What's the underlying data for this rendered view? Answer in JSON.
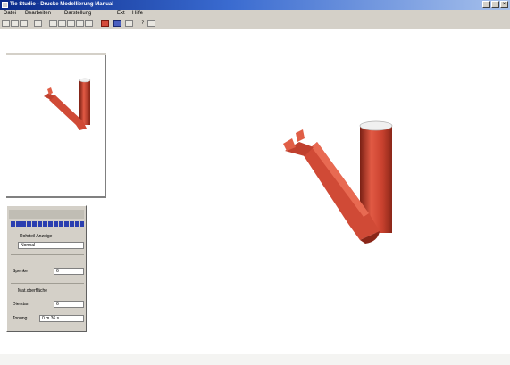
{
  "window": {
    "title": "Tie Studio - Drucke Modellierung Manual"
  },
  "menu": [
    "Datei",
    "Bearbeiten",
    "Darstellung",
    "Ext",
    "Hilfe"
  ],
  "toolbar": {
    "help_label": "?"
  },
  "control_panel": {
    "section1": "Rohrteil Anzeige",
    "select_value": "Normal",
    "row1_label": "Spenke",
    "row1_value": "6",
    "section2": "Mat.oberfläche",
    "row2_label": "Dierstan",
    "row2_value": "6",
    "row3_label": "Tonung",
    "row3_value": "0 m 36 s"
  },
  "colors": {
    "pipe": "#d9523e",
    "pipe_shadow": "#9a2c1e",
    "title_start": "#0a2a8a",
    "panel": "#d4d0c8"
  }
}
